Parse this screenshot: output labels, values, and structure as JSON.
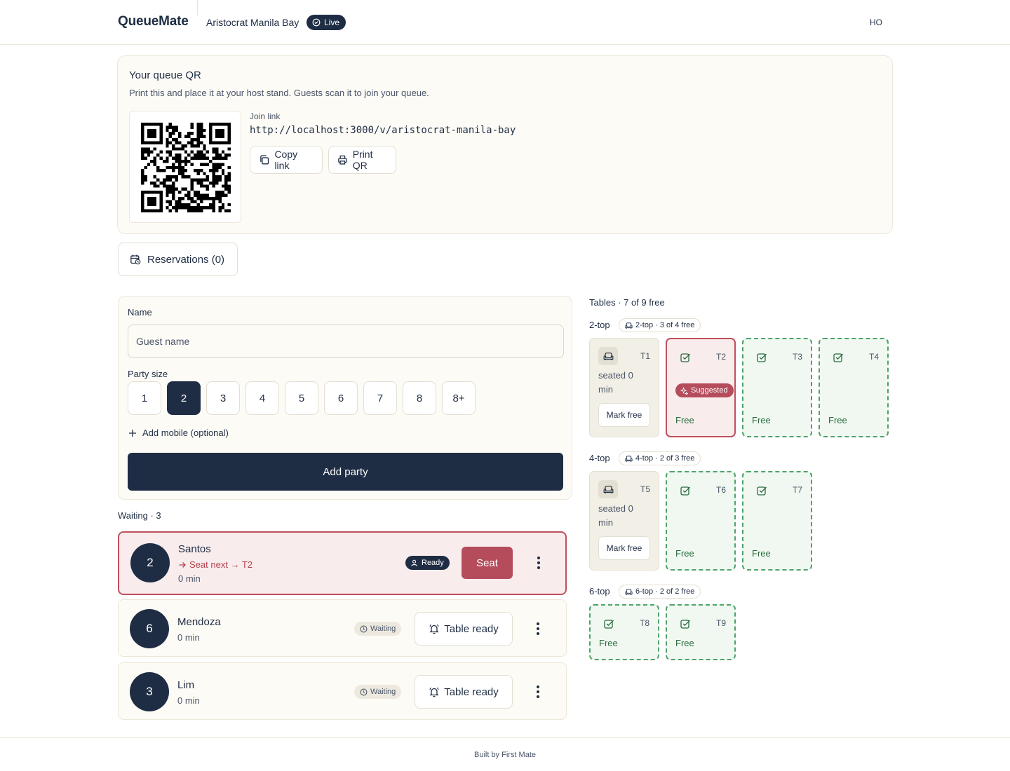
{
  "header": {
    "brand": "QueueMate",
    "venue": "Aristocrat Manila Bay",
    "live_label": "Live",
    "user_initials": "HO"
  },
  "qr": {
    "title": "Your queue QR",
    "description": "Print this and place it at your host stand. Guests scan it to join your queue.",
    "join_label": "Join link",
    "join_url": "http://localhost:3000/v/aristocrat-manila-bay",
    "copy_label": "Copy link",
    "print_label": "Print QR"
  },
  "reservations": {
    "label": "Reservations (0)"
  },
  "form": {
    "name_label": "Name",
    "name_placeholder": "Guest name",
    "name_value": "",
    "party_size_label": "Party size",
    "sizes": [
      "1",
      "2",
      "3",
      "4",
      "5",
      "6",
      "7",
      "8",
      "8+"
    ],
    "selected_size": "2",
    "add_mobile_label": "Add mobile (optional)",
    "submit_label": "Add party"
  },
  "waiting": {
    "title": "Waiting · 3",
    "parties": [
      {
        "size": "2",
        "name": "Santos",
        "seat_next": "Seat next → T2",
        "wait": "0 min",
        "status": "Ready",
        "action": "Seat"
      },
      {
        "size": "6",
        "name": "Mendoza",
        "wait": "0 min",
        "status": "Waiting",
        "action": "Table ready"
      },
      {
        "size": "3",
        "name": "Lim",
        "wait": "0 min",
        "status": "Waiting",
        "action": "Table ready"
      }
    ]
  },
  "tables": {
    "title": "Tables · 7 of 9 free",
    "groups": [
      {
        "label": "2-top",
        "chip": "2-top · 3 of 4 free"
      },
      {
        "label": "4-top",
        "chip": "4-top · 2 of 3 free"
      },
      {
        "label": "6-top",
        "chip": "6-top · 2 of 2 free"
      }
    ],
    "cards": [
      {
        "id": "T1",
        "state": "seated",
        "seated_text": "seated 0 min",
        "button": "Mark free"
      },
      {
        "id": "T2",
        "state": "suggested",
        "badge": "Suggested",
        "status": "Free"
      },
      {
        "id": "T3",
        "state": "free",
        "status": "Free"
      },
      {
        "id": "T4",
        "state": "free",
        "status": "Free"
      },
      {
        "id": "T5",
        "state": "seated",
        "seated_text": "seated 0 min",
        "button": "Mark free"
      },
      {
        "id": "T6",
        "state": "free",
        "status": "Free"
      },
      {
        "id": "T7",
        "state": "free",
        "status": "Free"
      },
      {
        "id": "T8",
        "state": "free",
        "status": "Free"
      },
      {
        "id": "T9",
        "state": "free",
        "status": "Free"
      }
    ]
  },
  "footer": {
    "text": "Built by First Mate"
  },
  "colors": {
    "navy": "#1f2d44",
    "accent_red": "#b54c5c",
    "free_green": "#4fa36b",
    "card_bg": "#fdfbf6"
  }
}
